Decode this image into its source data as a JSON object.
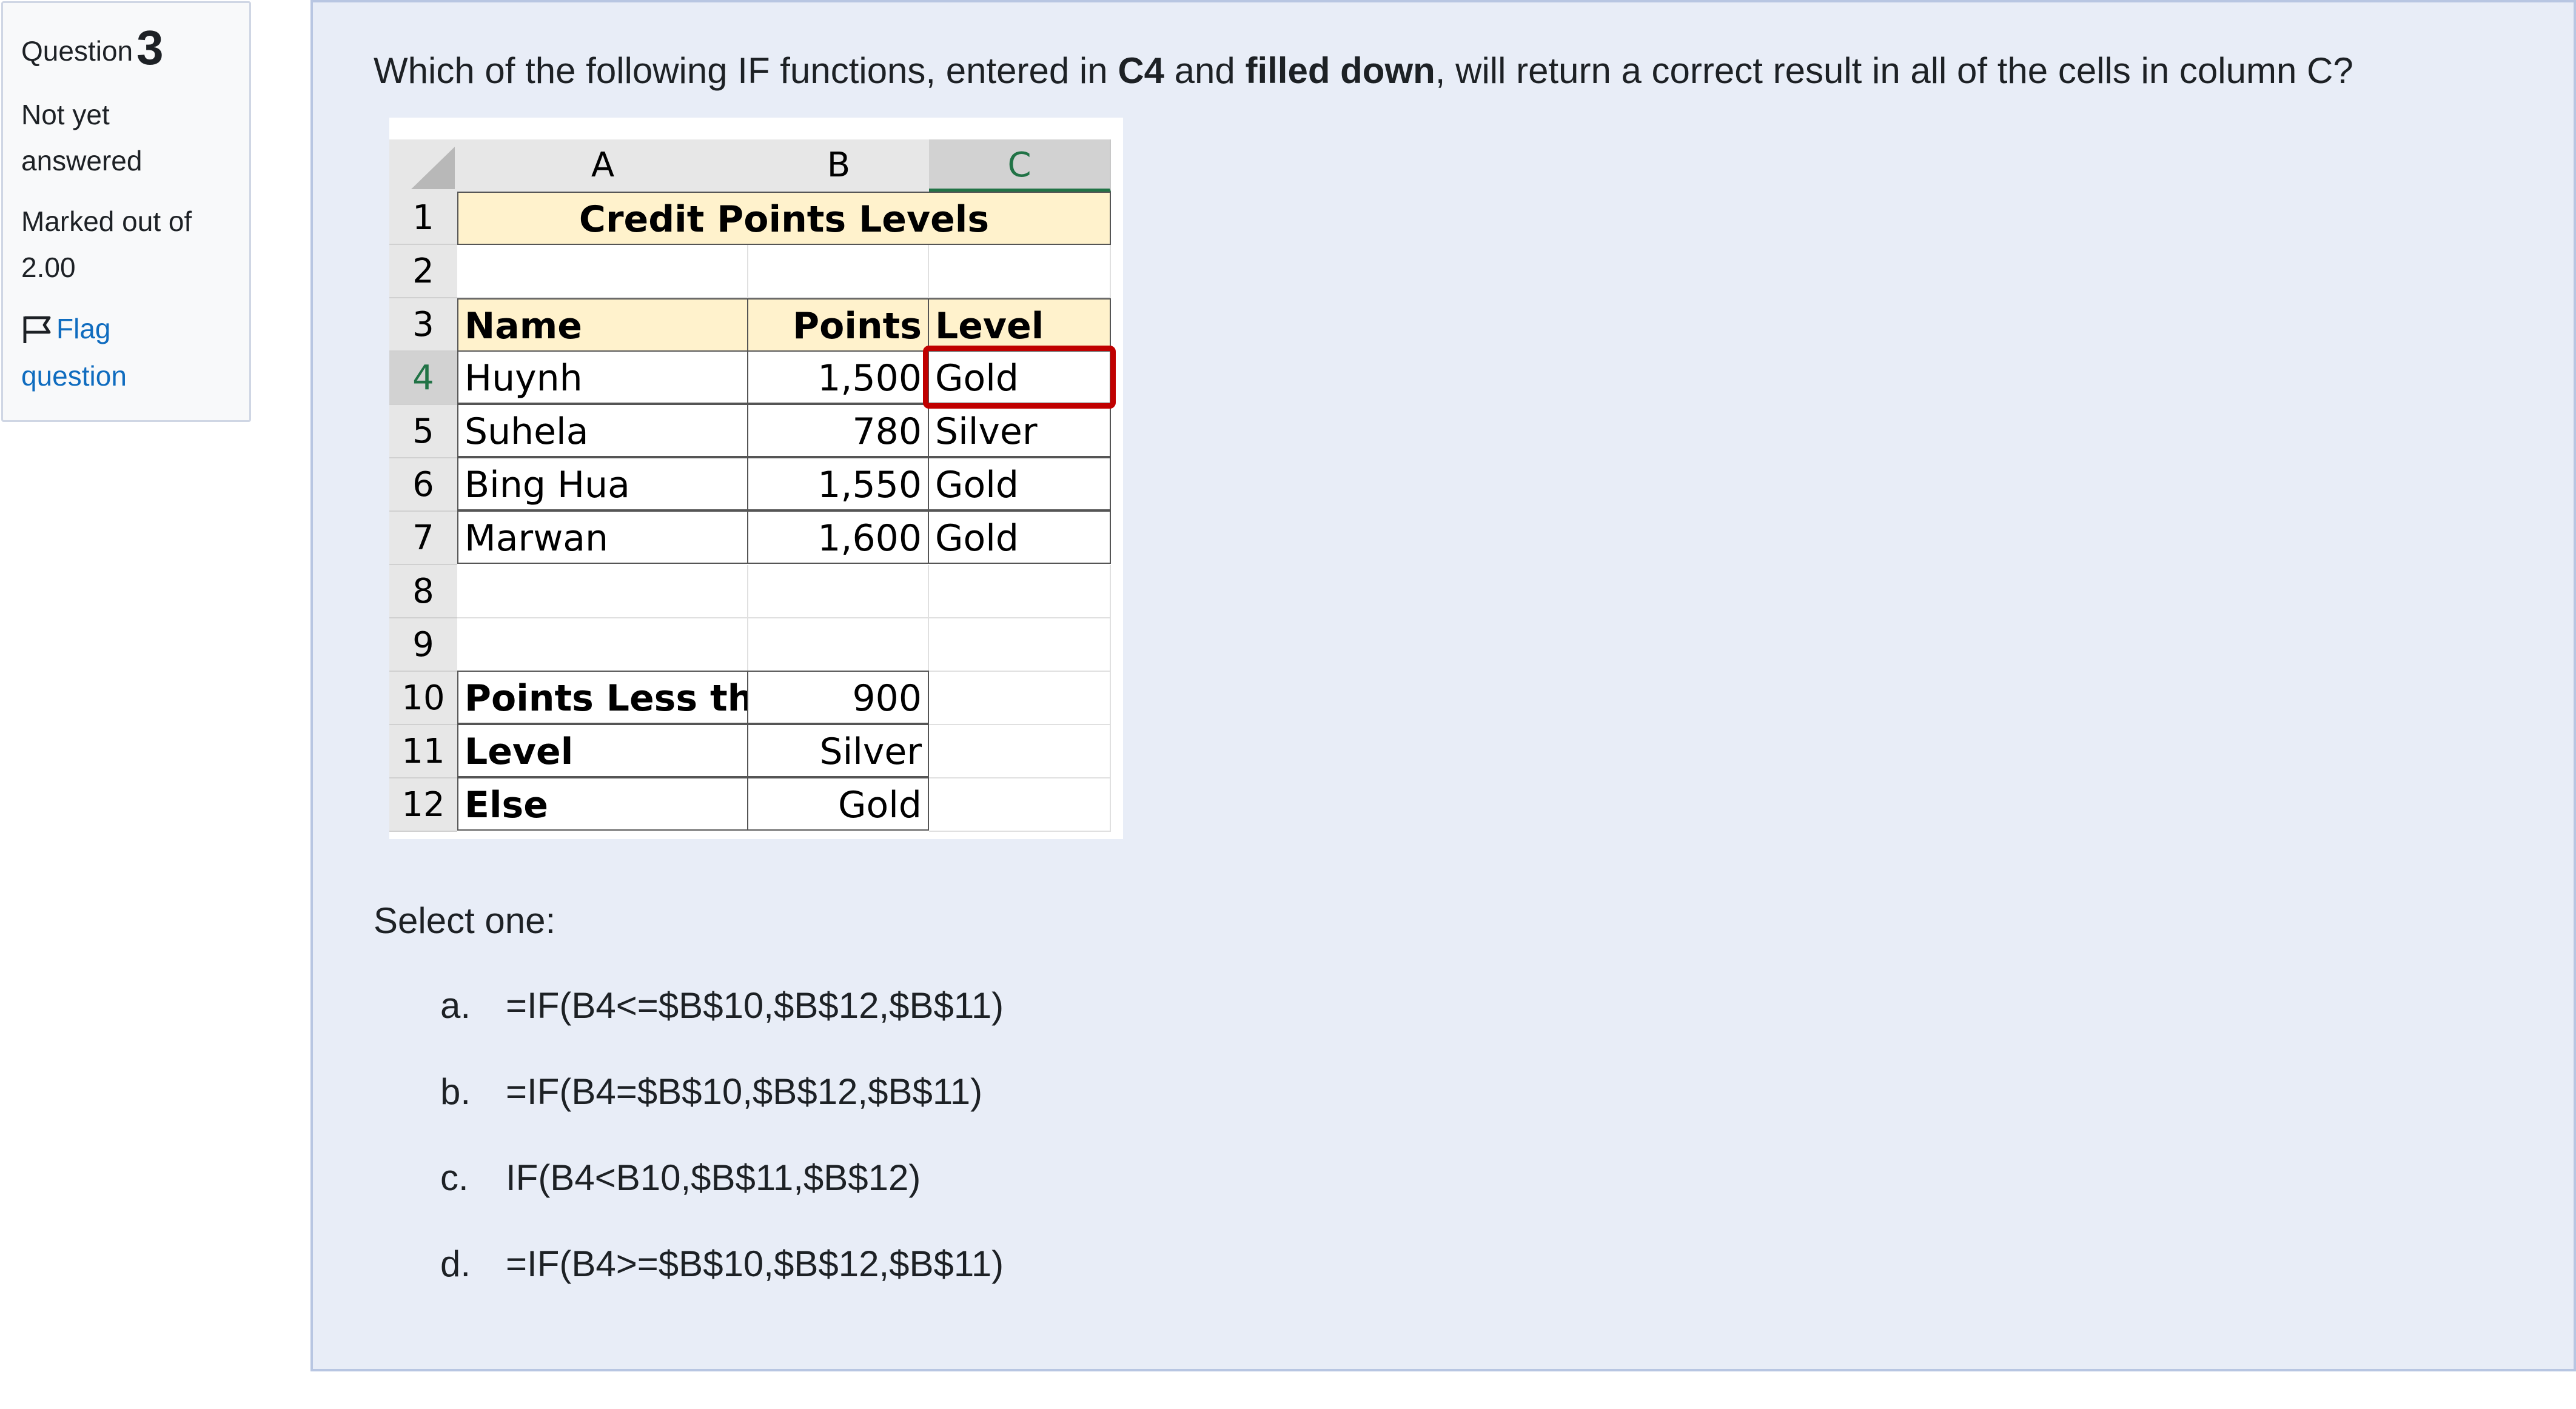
{
  "question": {
    "label": "Question",
    "number": "3",
    "status": "Not yet answered",
    "marked_out_of": "Marked out of 2.00",
    "flag_label": "Flag question",
    "text_parts": [
      "Which of the following IF functions, entered in ",
      "C4",
      " and ",
      "filled down",
      ", will return a correct result in all of the cells in column C?"
    ]
  },
  "sheet": {
    "columns": [
      "A",
      "B",
      "C"
    ],
    "rows": [
      "1",
      "2",
      "3",
      "4",
      "5",
      "6",
      "7",
      "8",
      "9",
      "10",
      "11",
      "12"
    ],
    "title": "Credit Points Levels",
    "headers": {
      "name": "Name",
      "points": "Points",
      "level": "Level"
    },
    "data": [
      {
        "name": "Huynh",
        "points": "1,500",
        "level": "Gold"
      },
      {
        "name": "Suhela",
        "points": "780",
        "level": "Silver"
      },
      {
        "name": "Bing Hua",
        "points": "1,550",
        "level": "Gold"
      },
      {
        "name": "Marwan",
        "points": "1,600",
        "level": "Gold"
      }
    ],
    "lookup": [
      {
        "label": "Points Less than",
        "value": "900"
      },
      {
        "label": "Level",
        "value": "Silver"
      },
      {
        "label": "Else",
        "value": "Gold"
      }
    ],
    "highlight_color": "#c00000",
    "header_fill": "#fff2cc"
  },
  "answer": {
    "prompt": "Select one:",
    "options": [
      {
        "letter": "a.",
        "text": "=IF(B4<=$B$10,$B$12,$B$11)"
      },
      {
        "letter": "b.",
        "text": "=IF(B4=$B$10,$B$12,$B$11)"
      },
      {
        "letter": "c.",
        "text": "IF(B4<B10,$B$11,$B$12)"
      },
      {
        "letter": "d.",
        "text": "=IF(B4>=$B$10,$B$12,$B$11)"
      }
    ]
  },
  "colors": {
    "link": "#0f6cbf",
    "question_bg": "#e8edf7",
    "info_bg": "#f8f9fa",
    "selected_header": "#217346"
  }
}
